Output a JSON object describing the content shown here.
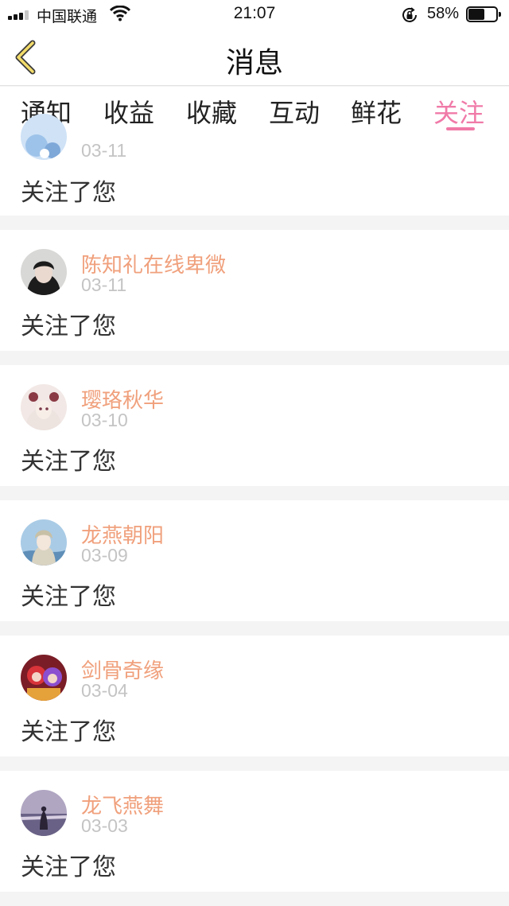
{
  "status_bar": {
    "carrier": "中国联通",
    "time": "21:07",
    "battery": "58%",
    "battery_level": 0.58
  },
  "nav": {
    "title": "消息"
  },
  "tabs": [
    {
      "label": "通知",
      "active": false
    },
    {
      "label": "收益",
      "active": false
    },
    {
      "label": "收藏",
      "active": false
    },
    {
      "label": "互动",
      "active": false
    },
    {
      "label": "鲜花",
      "active": false
    },
    {
      "label": "关注",
      "active": true
    }
  ],
  "colors": {
    "accent": "#f07aa8",
    "username": "#f0a07c",
    "date": "#c4c4c4",
    "separator": "#f4f4f4"
  },
  "messages": [
    {
      "name": "",
      "date": "03-11",
      "text": "关注了您"
    },
    {
      "name": "陈知礼在线卑微",
      "date": "03-11",
      "text": "关注了您"
    },
    {
      "name": "璎珞秋华",
      "date": "03-10",
      "text": "关注了您"
    },
    {
      "name": "龙燕朝阳",
      "date": "03-09",
      "text": "关注了您"
    },
    {
      "name": "剑骨奇缘",
      "date": "03-04",
      "text": "关注了您"
    },
    {
      "name": "龙飞燕舞",
      "date": "03-03",
      "text": "关注了您"
    }
  ]
}
